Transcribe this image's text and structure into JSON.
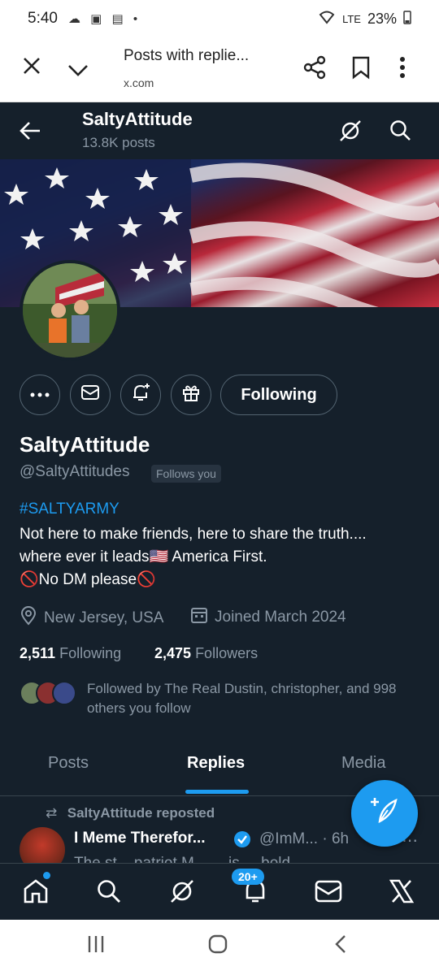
{
  "statusbar": {
    "time": "5:40",
    "battery": "23%",
    "network": "LTE"
  },
  "browser": {
    "title": "Posts with replie...",
    "url": "x.com"
  },
  "header": {
    "name": "SaltyAttitude",
    "posts_count": "13.8K posts"
  },
  "profile": {
    "display_name": "SaltyAttitude",
    "handle": "@SaltyAttitudes",
    "follows_you": "Follows you",
    "follow_button": "Following",
    "bio_tag": "#SALTYARMY",
    "bio_line1": "Not here to make friends, here to share the truth....",
    "bio_line2": "where ever it leads🇺🇸  America First.",
    "bio_line3": "🚫No DM please🚫",
    "location": "New Jersey, USA",
    "joined": "Joined March 2024",
    "following_count": "2,511",
    "following_label": "Following",
    "followers_count": "2,475",
    "followers_label": "Followers",
    "followed_by": "Followed by The Real Dustin, christopher, and 998 others you follow"
  },
  "tabs": [
    {
      "label": "Posts"
    },
    {
      "label": "Replies"
    },
    {
      "label": "Media"
    }
  ],
  "post": {
    "repost_label": "SaltyAttitude reposted",
    "author": "I Meme Therefor...",
    "handle_time": "@ImM... · 6h",
    "text_preview": "The st... patriot M... ... is ... bold ..."
  },
  "bottomnav": {
    "notifications_badge": "20+"
  },
  "colors": {
    "background": "#15202b",
    "accent": "#1d9bf0",
    "secondary_text": "#8b98a5",
    "border": "#536471"
  }
}
